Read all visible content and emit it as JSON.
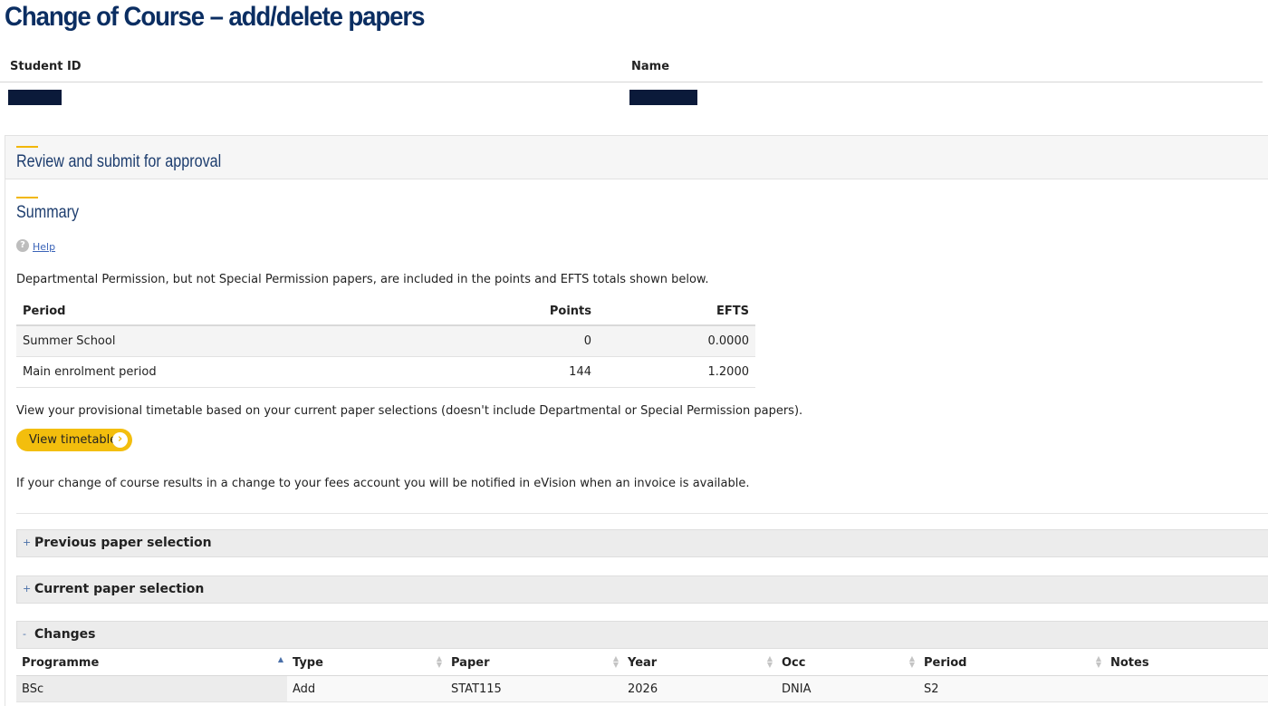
{
  "page": {
    "title": "Change of Course – add/delete papers"
  },
  "student": {
    "id_label": "Student ID",
    "name_label": "Name"
  },
  "review": {
    "title": "Review and submit for approval"
  },
  "summary": {
    "title": "Summary",
    "help_label": "Help",
    "note": "Departmental Permission, but not Special Permission papers, are included in the points and EFTS totals shown below.",
    "columns": [
      "Period",
      "Points",
      "EFTS"
    ],
    "rows": [
      {
        "period": "Summer School",
        "points": "0",
        "efts": "0.0000"
      },
      {
        "period": "Main enrolment period",
        "points": "144",
        "efts": "1.2000"
      }
    ],
    "timetable_note": "View your provisional timetable based on your current paper selections (doesn't include Departmental or Special Permission papers).",
    "timetable_button": "View timetable",
    "fees_note": "If your change of course results in a change to your fees account you will be notified in eVision when an invoice is available."
  },
  "sections": {
    "previous": {
      "symbol": "+",
      "label": "Previous paper selection"
    },
    "current": {
      "symbol": "+",
      "label": "Current paper selection"
    },
    "changes": {
      "symbol": "-",
      "label": "Changes"
    }
  },
  "changes_table": {
    "columns": [
      "Programme",
      "Type",
      "Paper",
      "Year",
      "Occ",
      "Period",
      "Notes"
    ],
    "rows": [
      {
        "programme": "BSc",
        "type": "Add",
        "paper": "STAT115",
        "year": "2026",
        "occ": "DNIA",
        "period": "S2",
        "notes": ""
      }
    ]
  },
  "colors": {
    "title": "#0b2e62",
    "accent": "#f2b705",
    "button": "#f3be0d",
    "link": "#3a63b8"
  }
}
